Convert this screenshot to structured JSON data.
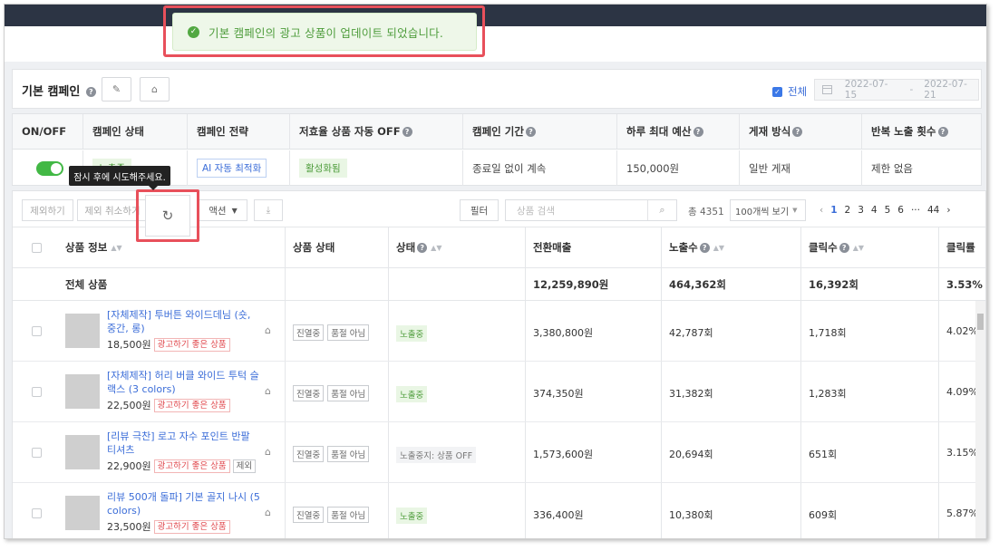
{
  "toast": {
    "message": "기본 캠페인의 광고 상품이 업데이트 되었습니다."
  },
  "campaign": {
    "title": "기본 캠페인",
    "all_label": "전체",
    "date_from": "2022-07-15",
    "date_sep": "-",
    "date_to": "2022-07-21"
  },
  "info": {
    "headers": [
      "ON/OFF",
      "캠페인 상태",
      "캠페인 전략",
      "저효율 상품 자동 OFF",
      "캠페인 기간",
      "하루 최대 예산",
      "게재 방식",
      "반복 노출 횟수"
    ],
    "status": "노출중",
    "strategy": "AI 자동 최적화",
    "auto_off": "활성화됨",
    "period": "종료일 없이 계속",
    "budget": "150,000원",
    "delivery": "일반 게재",
    "frequency": "제한 없음"
  },
  "toolbar": {
    "exclude": "제외하기",
    "unexclude": "제외 취소하기",
    "action": "액션",
    "filter": "필터",
    "search_placeholder": "상품 검색",
    "total": "총 4351",
    "page_size": "100개씩 보기",
    "pages": [
      "1",
      "2",
      "3",
      "4",
      "5",
      "6",
      "···",
      "44"
    ],
    "tooltip": "잠시 후에 시도해주세요."
  },
  "table": {
    "headers": [
      "상품 정보",
      "상품 상태",
      "상태",
      "전환매출",
      "노출수",
      "클릭수",
      "클릭률"
    ],
    "total_row": {
      "label": "전체 상품",
      "revenue": "12,259,890원",
      "impressions": "464,362회",
      "clicks": "16,392회",
      "ctr": "3.53%"
    },
    "rows": [
      {
        "name": "[자체제작] 투버튼 와이드데님 (숏, 중간, 롱)",
        "price": "18,500원",
        "badge": "광고하기 좋은 상품",
        "badge2": "",
        "tag1": "진열중",
        "tag2": "품절 아님",
        "status": "노출중",
        "revenue": "3,380,800원",
        "impressions": "42,787회",
        "clicks": "1,718회",
        "ctr": "4.02%"
      },
      {
        "name": "[자체제작] 허리 버클 와이드 투턱 슬랙스 (3 colors)",
        "price": "22,500원",
        "badge": "광고하기 좋은 상품",
        "badge2": "",
        "tag1": "진열중",
        "tag2": "품절 아님",
        "status": "노출중",
        "revenue": "374,350원",
        "impressions": "31,382회",
        "clicks": "1,283회",
        "ctr": "4.09%"
      },
      {
        "name": "[리뷰 극찬] 로고 자수 포인트 반팔 티셔츠",
        "price": "22,900원",
        "badge": "광고하기 좋은 상품",
        "badge2": "제외",
        "tag1": "진열중",
        "tag2": "품절 아님",
        "status": "노출중지: 상품 OFF",
        "revenue": "1,573,600원",
        "impressions": "20,694회",
        "clicks": "651회",
        "ctr": "3.15%"
      },
      {
        "name": "리뷰 500개 돌파] 기본 골지 나시 (5 colors)",
        "price": "23,500원",
        "badge": "광고하기 좋은 상품",
        "badge2": "",
        "tag1": "진열중",
        "tag2": "품절 아님",
        "status": "노출중",
        "revenue": "336,400원",
        "impressions": "10,380회",
        "clicks": "609회",
        "ctr": "5.87%"
      }
    ]
  },
  "colors": {
    "accent": "#3b78e7",
    "success": "#52a842",
    "highlight": "#e8505b"
  }
}
